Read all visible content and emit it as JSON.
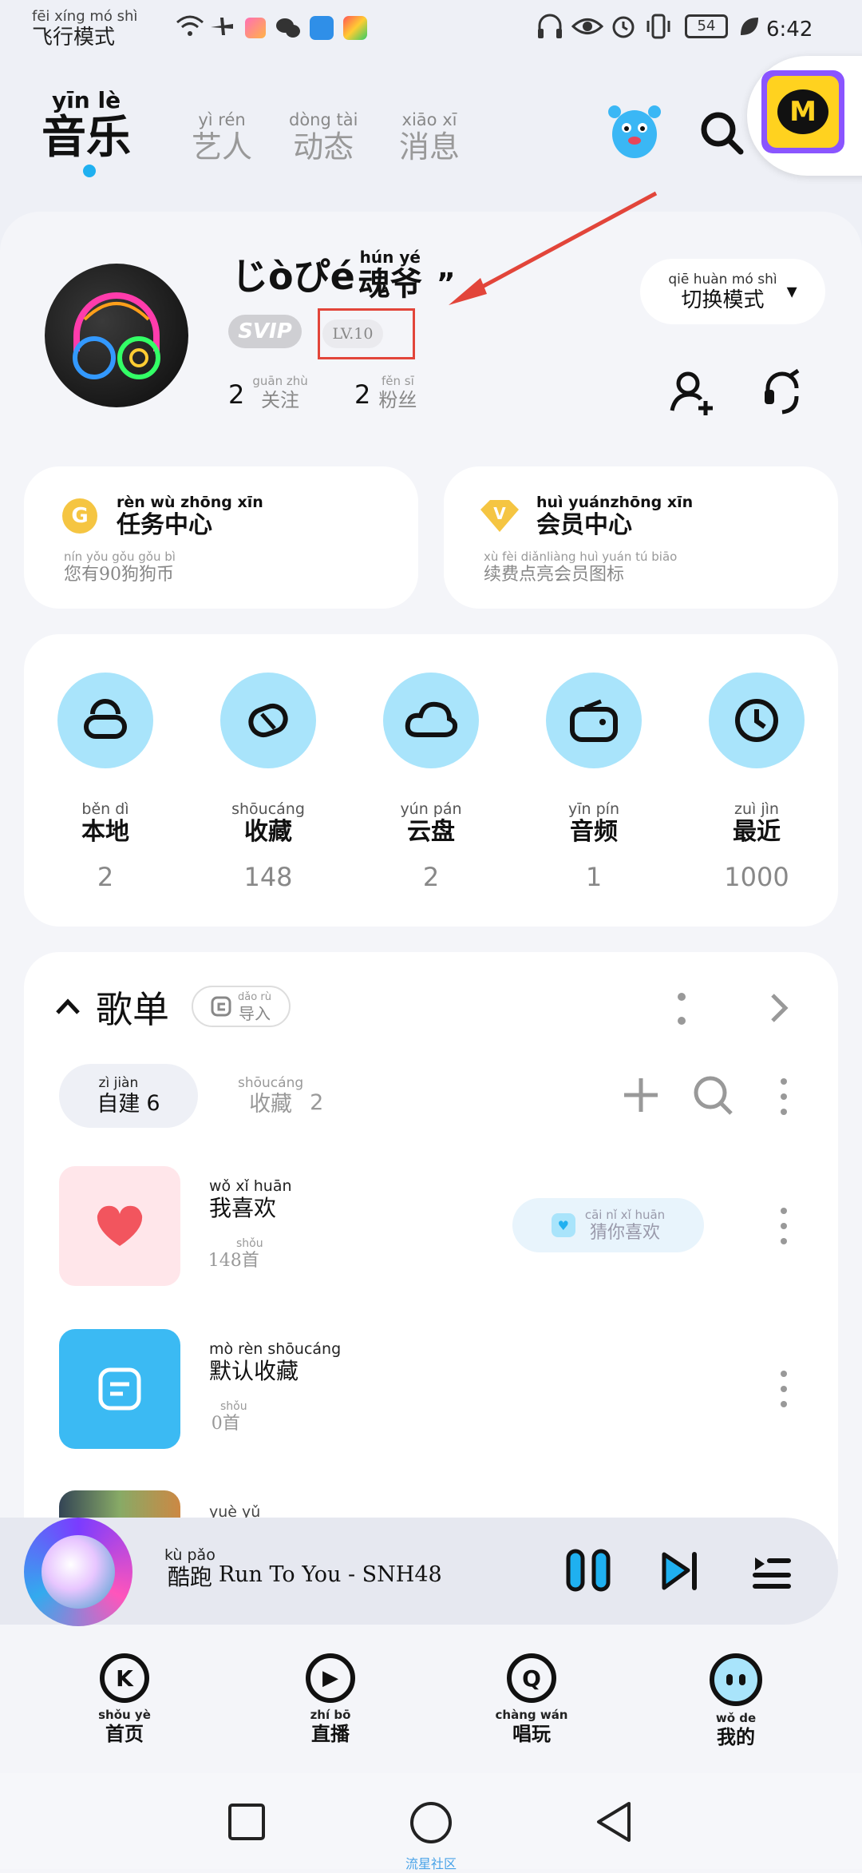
{
  "status": {
    "mode_pinyin": "fēi xíng mó shì",
    "mode_text": "飞行模式",
    "battery": "54",
    "time": "6:42"
  },
  "header": {
    "tabs": [
      {
        "pinyin": "yīn lè",
        "label": "音乐"
      },
      {
        "pinyin": "yì rén",
        "label": "艺人"
      },
      {
        "pinyin": "dòng tài",
        "label": "动态"
      },
      {
        "pinyin": "xiāo xī",
        "label": "消息"
      }
    ],
    "app_badge": "M"
  },
  "profile": {
    "name_prefix": "じòぴé",
    "name_pinyin": "hún yé",
    "name_suffix": "魂爷",
    "name_tail": "”",
    "svip": "SVIP",
    "level": "LV.10",
    "follow_count": "2",
    "follow_pinyin": "guān zhù",
    "follow_label": "关注",
    "fans_count": "2",
    "fans_pinyin": "fěn sī",
    "fans_label": "粉丝",
    "switch_pinyin": "qiē huàn mó shì",
    "switch_label": "切换模式",
    "switch_caret": "▾"
  },
  "tasks": {
    "task_pinyin": "rèn wù zhōng xīn",
    "task_title": "任务中心",
    "task_sub_pinyin": "nín yǒu        gǒu gǒu bì",
    "task_sub": "您有90狗狗币",
    "vip_pinyin": "huì yuánzhōng xīn",
    "vip_title": "会员中心",
    "vip_sub_pinyin": "xù fèi diǎnliàng huì yuán tú biāo",
    "vip_sub": "续费点亮会员图标"
  },
  "library": [
    {
      "pinyin": "běn dì",
      "label": "本地",
      "count": "2"
    },
    {
      "pinyin": "shōucáng",
      "label": "收藏",
      "count": "148"
    },
    {
      "pinyin": "yún pán",
      "label": "云盘",
      "count": "2"
    },
    {
      "pinyin": "yīn pín",
      "label": "音频",
      "count": "1"
    },
    {
      "pinyin": "zuì jìn",
      "label": "最近",
      "count": "1000"
    }
  ],
  "playlists": {
    "title": "歌单",
    "import_pinyin": "dǎo rù",
    "import_label": "导入",
    "tab_own_pinyin": "zì jiàn",
    "tab_own_label": "自建",
    "tab_own_count": "6",
    "tab_fav_pinyin": "shōucáng",
    "tab_fav_label": "收藏",
    "tab_fav_count": "2",
    "items": [
      {
        "pinyin": "wǒ xǐ huān",
        "title": "我喜欢",
        "count_pinyin": "shǒu",
        "count": "148首",
        "guess_pinyin": "cāi nǐ xǐ huān",
        "guess_label": "猜你喜欢"
      },
      {
        "pinyin": "mò rèn shōucáng",
        "title": "默认收藏",
        "count_pinyin": "shǒu",
        "count": "0首"
      },
      {
        "pinyin": "yuè yǔ",
        "title": ""
      }
    ]
  },
  "player": {
    "song_pinyin": "kù pǎo",
    "song_prefix": "酷跑",
    "song_text": "Run To You - SNH48"
  },
  "bottom_nav": [
    {
      "pinyin": "shǒu yè",
      "label": "首页",
      "glyph": "K"
    },
    {
      "pinyin": "zhí bō",
      "label": "直播",
      "glyph": "▶"
    },
    {
      "pinyin": "chàng wán",
      "label": "唱玩",
      "glyph": "Q"
    },
    {
      "pinyin": "wǒ de",
      "label": "我的",
      "glyph": ""
    }
  ],
  "system_nav": {
    "watermark": "流星社区"
  }
}
